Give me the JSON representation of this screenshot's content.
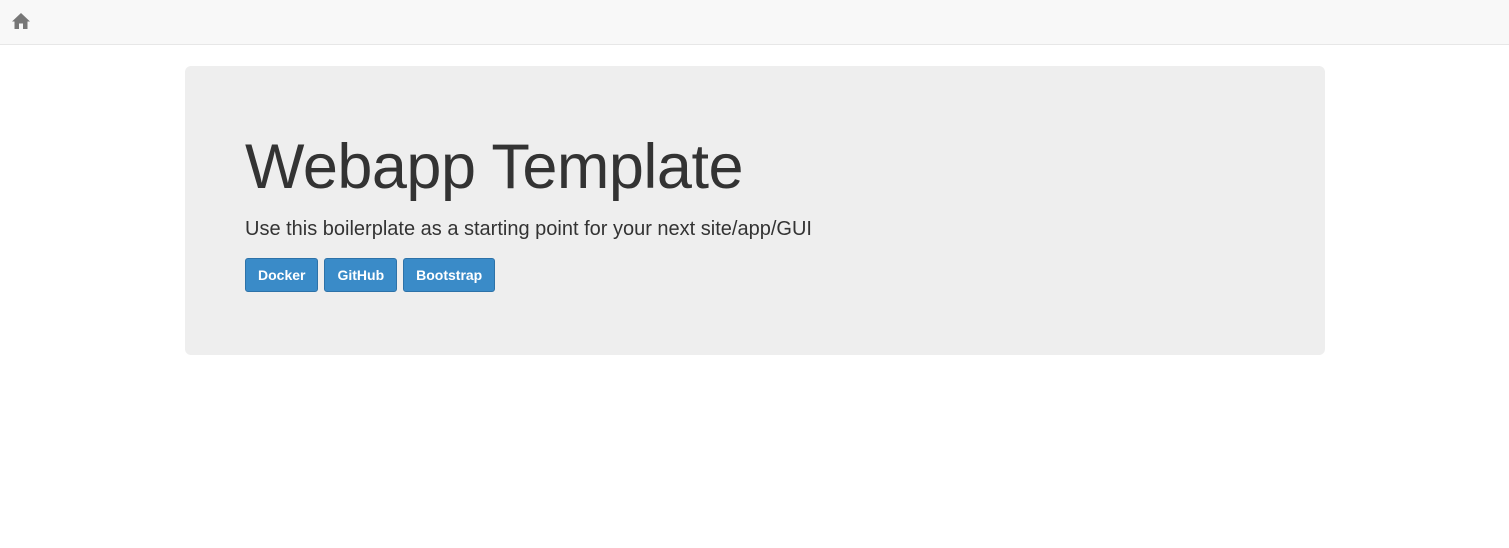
{
  "navbar": {
    "home_icon": "home-icon",
    "icon_color": "#777777"
  },
  "jumbotron": {
    "title": "Webapp Template",
    "lead": "Use this boilerplate as a starting point for your next site/app/GUI",
    "buttons": [
      {
        "label": "Docker"
      },
      {
        "label": "GitHub"
      },
      {
        "label": "Bootstrap"
      }
    ]
  },
  "colors": {
    "navbar_bg": "#f8f8f8",
    "jumbotron_bg": "#eeeeee",
    "button_primary": "#3a8bc8",
    "text": "#333333"
  }
}
